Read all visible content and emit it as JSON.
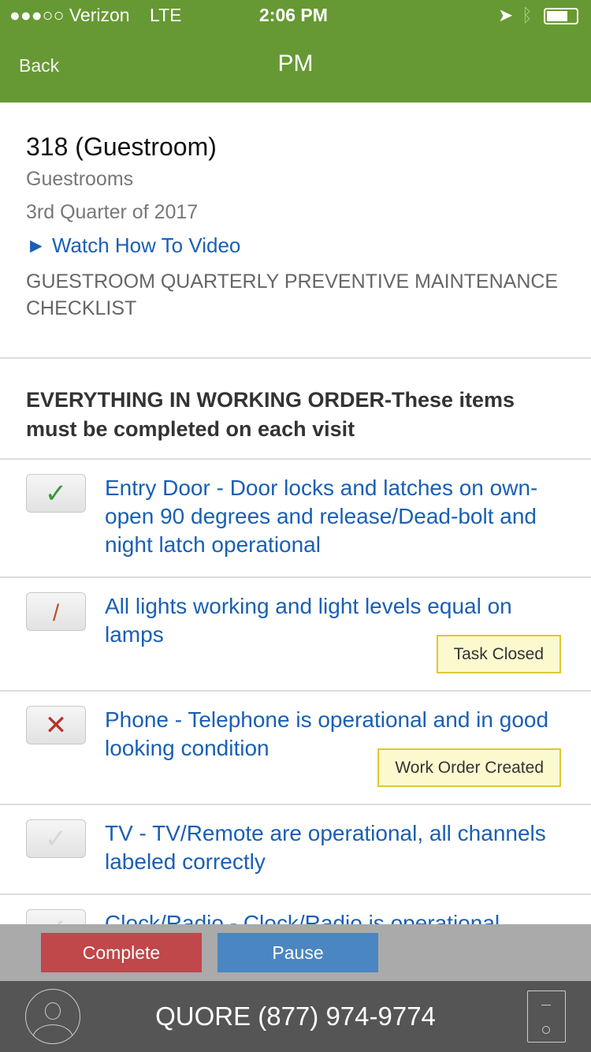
{
  "status": {
    "carrier": "●●●○○ Verizon",
    "network": "LTE",
    "time": "2:06 PM"
  },
  "nav": {
    "back": "Back",
    "title": "PM"
  },
  "info": {
    "title": "318 (Guestroom)",
    "category": "Guestrooms",
    "period": "3rd Quarter of 2017",
    "video_link": "► Watch How To Video",
    "checklist_name": "GUESTROOM QUARTERLY PREVENTIVE MAINTENANCE CHECKLIST"
  },
  "section": {
    "heading": "EVERYTHING IN WORKING ORDER-These items must be completed on each visit"
  },
  "items": [
    {
      "text": "Entry Door - Door locks and latches on own- open 90 degrees and release/Dead-bolt and night latch operational",
      "state": "checked",
      "icon": "✓",
      "badge": ""
    },
    {
      "text": "All lights working and light levels equal on lamps",
      "state": "slash",
      "icon": "/",
      "badge": "Task Closed"
    },
    {
      "text": "Phone - Telephone is operational and in good looking condition",
      "state": "failed",
      "icon": "✕",
      "badge": "Work Order Created"
    },
    {
      "text": "TV - TV/Remote are operational, all channels labeled correctly",
      "state": "unchecked",
      "icon": "✓",
      "badge": ""
    },
    {
      "text": "Clock/Radio - Clock/Radio is operational",
      "state": "unchecked",
      "icon": "✓",
      "badge": ""
    }
  ],
  "actions": {
    "complete": "Complete",
    "pause": "Pause"
  },
  "footer": {
    "text": "QUORE (877) 974-9774"
  },
  "colors": {
    "header": "#669933",
    "complete": "#c0474a",
    "pause": "#4a86c2",
    "link": "#1a5fb4"
  }
}
